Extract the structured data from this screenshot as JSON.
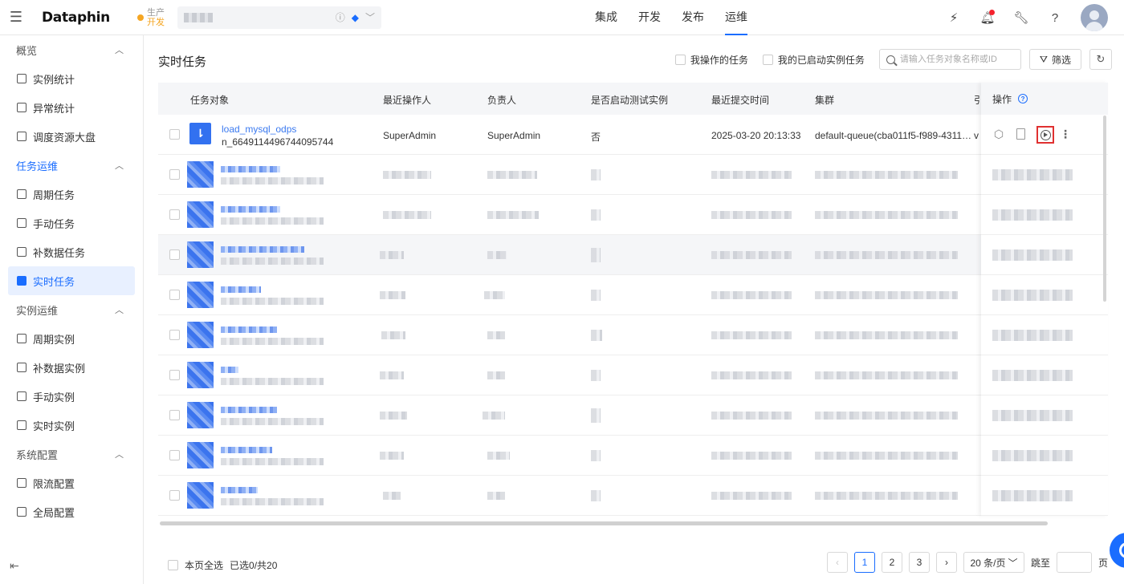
{
  "app": {
    "logo": "Dataphin",
    "env_prod": "生产",
    "env_dev": "开发"
  },
  "top_nav": {
    "items": [
      {
        "label": "集成"
      },
      {
        "label": "开发"
      },
      {
        "label": "发布"
      },
      {
        "label": "运维",
        "active": true
      }
    ]
  },
  "sidebar": {
    "groups": [
      {
        "label": "概览",
        "items": [
          "实例统计",
          "异常统计",
          "调度资源大盘"
        ]
      },
      {
        "label": "任务运维",
        "active": true,
        "items": [
          "周期任务",
          "手动任务",
          "补数据任务",
          "实时任务"
        ]
      },
      {
        "label": "实例运维",
        "items": [
          "周期实例",
          "补数据实例",
          "手动实例",
          "实时实例"
        ]
      },
      {
        "label": "系统配置",
        "items": [
          "限流配置",
          "全局配置"
        ]
      }
    ],
    "active_item": "实时任务"
  },
  "page": {
    "title": "实时任务",
    "filter_my_operated": "我操作的任务",
    "filter_my_started": "我的已启动实例任务",
    "search_placeholder": "请输入任务对象名称或ID",
    "filter_button": "筛选"
  },
  "table": {
    "columns": {
      "task": "任务对象",
      "operator": "最近操作人",
      "owner": "负责人",
      "test_instance": "是否启动测试实例",
      "submit_time": "最近提交时间",
      "cluster": "集群",
      "extra": "引",
      "ops": "操作"
    },
    "first_row": {
      "name": "load_mysql_odps",
      "id": "n_6649114496744095744",
      "operator": "SuperAdmin",
      "owner": "SuperAdmin",
      "test_instance": "否",
      "submit_time": "2025-03-20 20:13:33",
      "cluster": "default-queue(cba011f5-f989-4311…",
      "extra": "v"
    }
  },
  "footer": {
    "select_all": "本页全选",
    "selected_count": "已选0/共20",
    "pages": [
      "1",
      "2",
      "3"
    ],
    "current_page": "1",
    "page_size": "20 条/页",
    "jump_label": "跳至",
    "page_unit": "页"
  }
}
